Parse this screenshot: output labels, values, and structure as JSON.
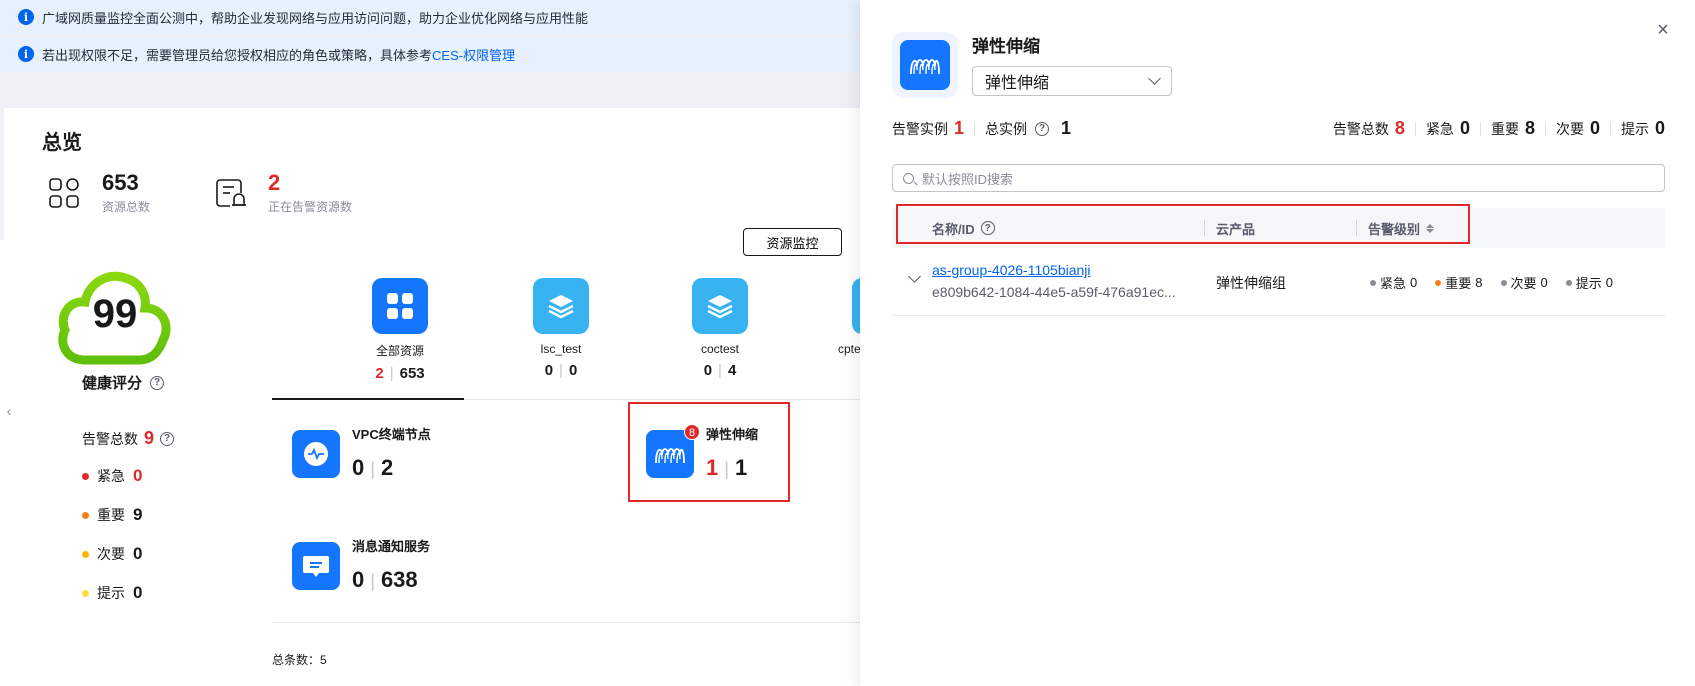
{
  "banners": [
    {
      "text": "广域网质量监控全面公测中，帮助企业发现网络与应用访问问题，助力企业优化网络与应用性能",
      "link": ""
    },
    {
      "text": "若出现权限不足，需要管理员给您授权相应的角色或策略，具体参考",
      "link": "CES-权限管理"
    }
  ],
  "overview": {
    "title": "总览",
    "resource_total": "653",
    "resource_total_label": "资源总数",
    "alarming_resources": "2",
    "alarming_resources_label": "正在告警资源数",
    "resource_monitor_button": "资源监控"
  },
  "health": {
    "score": "99",
    "label": "健康评分",
    "alarm_total_label": "告警总数",
    "alarm_total": "9",
    "levels": [
      {
        "label": "紧急",
        "count": "0",
        "color": "#e02a2a"
      },
      {
        "label": "重要",
        "count": "9",
        "color": "#f57f17"
      },
      {
        "label": "次要",
        "count": "0",
        "color": "#ffb400"
      },
      {
        "label": "提示",
        "count": "0",
        "color": "#ffde3b"
      }
    ]
  },
  "categories": [
    {
      "name": "全部资源",
      "alarm": "2",
      "total": "653",
      "icon": "grid-icon",
      "color": "#1476ff"
    },
    {
      "name": "lsc_test",
      "alarm": "0",
      "total": "0",
      "icon": "layers-icon",
      "color": "#36b3f0"
    },
    {
      "name": "coctest",
      "alarm": "0",
      "total": "4",
      "icon": "layers-icon",
      "color": "#36b3f0"
    },
    {
      "name": "cpte",
      "alarm": "",
      "total": "",
      "icon": "layers-icon",
      "color": "#36b3f0"
    }
  ],
  "services": [
    {
      "name": "VPC终端节点",
      "alarm": "0",
      "total": "2",
      "icon": "vpc-endpoint-icon"
    },
    {
      "name": "弹性伸缩",
      "alarm": "1",
      "total": "1",
      "icon": "auto-scaling-icon",
      "badge": "8"
    },
    {
      "name": "消息通知服务",
      "alarm": "0",
      "total": "638",
      "icon": "message-notification-icon"
    }
  ],
  "total_count": "总条数：5",
  "drawer": {
    "title": "弹性伸缩",
    "select_value": "弹性伸缩",
    "alarm_instances_label": "告警实例",
    "alarm_instances": "1",
    "total_instances_label": "总实例",
    "total_instances": "1",
    "alarm_total_label": "告警总数",
    "alarm_total": "8",
    "levels": [
      {
        "label": "紧急",
        "count": "0"
      },
      {
        "label": "重要",
        "count": "8"
      },
      {
        "label": "次要",
        "count": "0"
      },
      {
        "label": "提示",
        "count": "0"
      }
    ],
    "search_placeholder": "默认按照ID搜索",
    "columns": [
      "名称/ID",
      "云产品",
      "告警级别"
    ],
    "rows": [
      {
        "name": "as-group-4026-1105bianji",
        "id": "e809b642-1084-44e5-a59f-476a91ec...",
        "product": "弹性伸缩组",
        "levels": [
          {
            "label": "紧急",
            "count": "0",
            "color": "#8a8e99"
          },
          {
            "label": "重要",
            "count": "8",
            "color": "#f57f17"
          },
          {
            "label": "次要",
            "count": "0",
            "color": "#8a8e99"
          },
          {
            "label": "提示",
            "count": "0",
            "color": "#8a8e99"
          }
        ]
      }
    ]
  }
}
